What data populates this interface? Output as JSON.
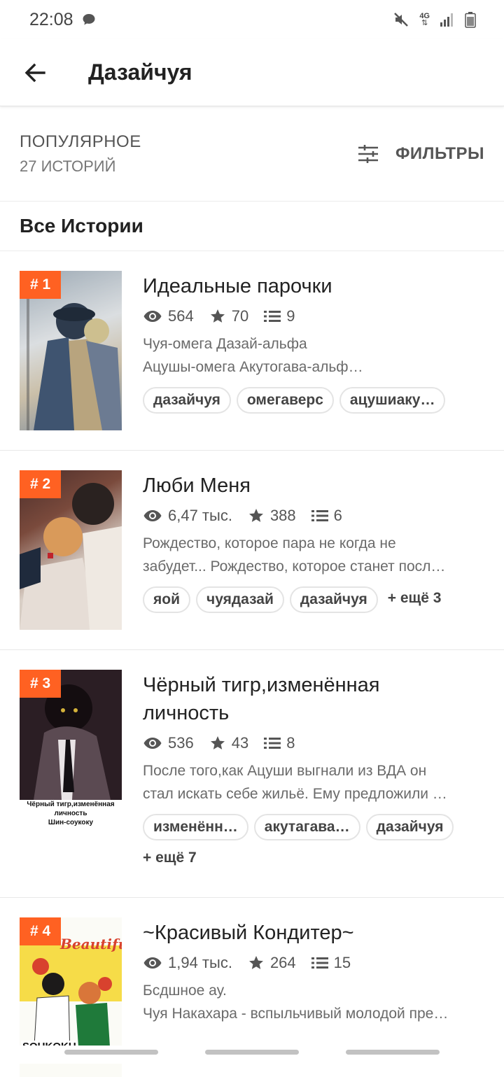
{
  "status": {
    "time": "22:08",
    "network": "4G"
  },
  "appbar": {
    "title": "Дазайчуя"
  },
  "sort": {
    "label": "ПОПУЛЯРНОЕ",
    "count": "27 ИСТОРИЙ",
    "filters_label": "ФИЛЬТРЫ"
  },
  "section": {
    "title": "Все Истории"
  },
  "colors": {
    "accent": "#ff6122"
  },
  "stories": [
    {
      "rank": "# 1",
      "title": "Идеальные парочки",
      "views": "564",
      "stars": "70",
      "parts": "9",
      "desc1": "Чуя-омега Дазай-альфа",
      "desc2": "Ацушы-омега Акутогава-альф…",
      "tags": [
        "дазайчуя",
        "омегаверс",
        "ацушиаку…"
      ]
    },
    {
      "rank": "# 2",
      "title": "Люби Меня",
      "views": "6,47 тыс.",
      "stars": "388",
      "parts": "6",
      "desc1": "Рождество, которое пара не когда не",
      "desc2": "забудет... Рождество, которое станет посл…",
      "tags": [
        "яой",
        "чуядазай",
        "дазайчуя"
      ],
      "more": "+ ещё 3"
    },
    {
      "rank": "# 3",
      "title1": "Чёрный тигр,изменённая",
      "title2": "личность",
      "views": "536",
      "stars": "43",
      "parts": "8",
      "desc1": "После того,как Ацуши выгнали из ВДА  он",
      "desc2": "стал искать себе  жильё. Ему предложили …",
      "tags": [
        "изменённ…",
        "акутагава…",
        "дазайчуя"
      ],
      "more": "+ ещё 7",
      "cover_caption1": "Чёрный тигр,изменённая",
      "cover_caption2": "личность",
      "cover_caption3": "Шин-соукоку"
    },
    {
      "rank": "# 4",
      "title": "~Красивый Кондитер~",
      "views": "1,94 тыс.",
      "stars": "264",
      "parts": "15",
      "desc1": "Бсдшное ау.",
      "desc2": "Чуя Накахара - вспыльчивый молодой пре…",
      "cover_text1": "Beautiful",
      "cover_text2": "SOUKOKU"
    }
  ]
}
